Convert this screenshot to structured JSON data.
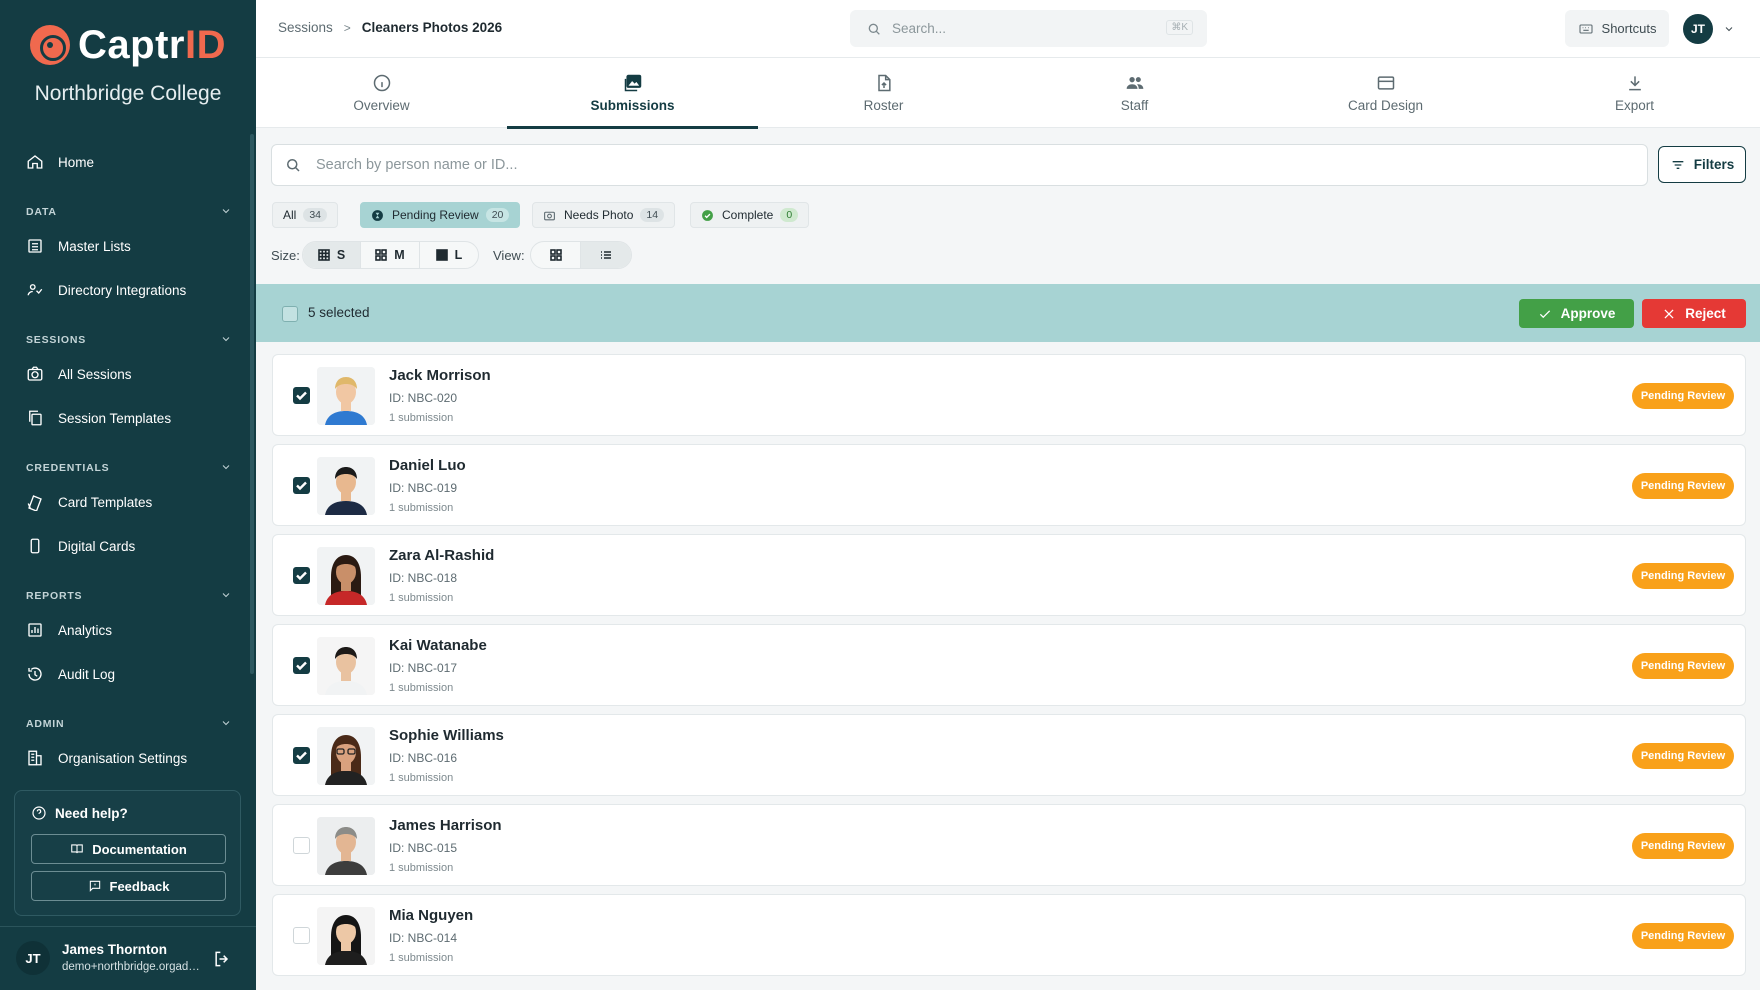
{
  "brand": {
    "logo_word": "Captr",
    "logo_accent": "ID",
    "org_name": "Northbridge College",
    "colors": {
      "sidebar": "#143c43",
      "accent": "#f0694e",
      "selection": "#a7d3d3",
      "approve": "#43a047",
      "reject": "#e53935",
      "pending": "#f9a11a"
    }
  },
  "sidebar": {
    "home": {
      "label": "Home",
      "icon": "home-icon"
    },
    "sections": [
      {
        "title": "DATA",
        "items": [
          {
            "label": "Master Lists",
            "icon": "list-icon"
          },
          {
            "label": "Directory Integrations",
            "icon": "directory-icon"
          }
        ]
      },
      {
        "title": "SESSIONS",
        "items": [
          {
            "label": "All Sessions",
            "icon": "camera-icon"
          },
          {
            "label": "Session Templates",
            "icon": "copy-icon"
          }
        ]
      },
      {
        "title": "CREDENTIALS",
        "items": [
          {
            "label": "Card Templates",
            "icon": "cards-icon"
          },
          {
            "label": "Digital Cards",
            "icon": "phone-icon"
          }
        ]
      },
      {
        "title": "REPORTS",
        "items": [
          {
            "label": "Analytics",
            "icon": "chart-icon"
          },
          {
            "label": "Audit Log",
            "icon": "history-icon"
          }
        ]
      },
      {
        "title": "ADMIN",
        "items": [
          {
            "label": "Organisation Settings",
            "icon": "building-icon"
          }
        ]
      }
    ],
    "help": {
      "title": "Need help?",
      "documentation": "Documentation",
      "feedback": "Feedback"
    },
    "user": {
      "initials": "JT",
      "name": "James Thornton",
      "email": "demo+northbridge.orgadmin@captrid.com"
    }
  },
  "topbar": {
    "breadcrumb": {
      "parent": "Sessions",
      "separator": ">",
      "current": "Cleaners Photos 2026"
    },
    "search": {
      "placeholder": "Search...",
      "shortcut": "⌘K"
    },
    "shortcuts_label": "Shortcuts",
    "avatar_initials": "JT"
  },
  "tabs": [
    {
      "label": "Overview",
      "icon": "info-icon",
      "active": false
    },
    {
      "label": "Submissions",
      "icon": "photos-icon",
      "active": true
    },
    {
      "label": "Roster",
      "icon": "upload-file-icon",
      "active": false
    },
    {
      "label": "Staff",
      "icon": "people-icon",
      "active": false
    },
    {
      "label": "Card Design",
      "icon": "card-icon",
      "active": false
    },
    {
      "label": "Export",
      "icon": "download-icon",
      "active": false
    }
  ],
  "filters": {
    "search_placeholder": "Search by person name or ID...",
    "filters_label": "Filters",
    "chips": [
      {
        "label": "All",
        "count": "34",
        "active": false
      },
      {
        "label": "Pending Review",
        "count": "20",
        "active": true
      },
      {
        "label": "Needs Photo",
        "count": "14",
        "active": false
      },
      {
        "label": "Complete",
        "count": "0",
        "active": false
      }
    ],
    "size_label": "Size:",
    "sizes": [
      "S",
      "M",
      "L"
    ],
    "selected_size": "S",
    "view_label": "View:",
    "selected_view": "list"
  },
  "selection": {
    "text": "5 selected",
    "approve": "Approve",
    "reject": "Reject"
  },
  "people": [
    {
      "name": "Jack Morrison",
      "id": "ID: NBC-020",
      "submissions": "1 submission",
      "status": "Pending Review",
      "selected": true
    },
    {
      "name": "Daniel Luo",
      "id": "ID: NBC-019",
      "submissions": "1 submission",
      "status": "Pending Review",
      "selected": true
    },
    {
      "name": "Zara Al-Rashid",
      "id": "ID: NBC-018",
      "submissions": "1 submission",
      "status": "Pending Review",
      "selected": true
    },
    {
      "name": "Kai Watanabe",
      "id": "ID: NBC-017",
      "submissions": "1 submission",
      "status": "Pending Review",
      "selected": true
    },
    {
      "name": "Sophie Williams",
      "id": "ID: NBC-016",
      "submissions": "1 submission",
      "status": "Pending Review",
      "selected": true
    },
    {
      "name": "James Harrison",
      "id": "ID: NBC-015",
      "submissions": "1 submission",
      "status": "Pending Review",
      "selected": false
    },
    {
      "name": "Mia Nguyen",
      "id": "ID: NBC-014",
      "submissions": "1 submission",
      "status": "Pending Review",
      "selected": false
    }
  ]
}
